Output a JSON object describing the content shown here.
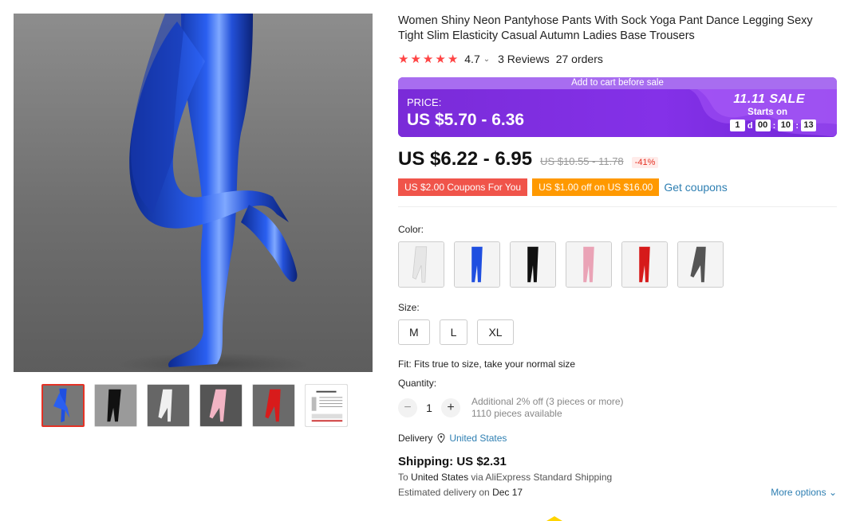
{
  "product": {
    "title": "Women Shiny Neon Pantyhose Pants With Sock Yoga Pant Dance Legging Sexy Tight Slim Elasticity Casual Autumn Ladies Base Trousers",
    "rating": "4.7",
    "reviews": "3 Reviews",
    "orders": "27 orders"
  },
  "banner": {
    "top_text": "Add to cart before sale",
    "price_label": "PRICE:",
    "sale_price": "US $5.70 - 6.36",
    "sale_name": "11.11 SALE",
    "starts_on": "Starts on",
    "countdown": {
      "days": "1",
      "days_unit": "d",
      "hours": "00",
      "minutes": "10",
      "seconds": "13"
    },
    "colors": {
      "bg": "#7a2bd8",
      "top": "#a86df0"
    }
  },
  "pricing": {
    "price": "US $6.22 - 6.95",
    "original_price": "US $10.55 - 11.78",
    "discount": "-41%"
  },
  "coupons": {
    "coupon_1": "US $2.00 Coupons For You",
    "coupon_2": "US $1.00 off on US $16.00",
    "get_coupons": "Get coupons"
  },
  "options": {
    "color_label": "Color:",
    "colors": [
      "white",
      "blue",
      "black",
      "pink",
      "red",
      "grey"
    ],
    "size_label": "Size:",
    "sizes": [
      "M",
      "L",
      "XL"
    ],
    "fit_text": "Fit: Fits true to size, take your normal size",
    "quantity_label": "Quantity:",
    "quantity": "1",
    "minus": "−",
    "plus": "+",
    "qty_discount": "Additional 2% off (3 pieces or more)",
    "available": "1110 pieces available"
  },
  "delivery": {
    "label": "Delivery",
    "location": "United States",
    "shipping": "Shipping: US $2.31",
    "to_prefix": "To",
    "to_country": "United States",
    "via": "via AliExpress Standard Shipping",
    "eta_prefix": "Estimated delivery on",
    "eta_date": "Dec 17",
    "more_options": "More options"
  },
  "gallery": {
    "thumb_icons": [
      "thumb-blue-leggings",
      "thumb-black-leggings",
      "thumb-white-leggings",
      "thumb-pink-leggings",
      "thumb-red-leggings",
      "thumb-size-chart"
    ],
    "accent": "#e43225"
  }
}
